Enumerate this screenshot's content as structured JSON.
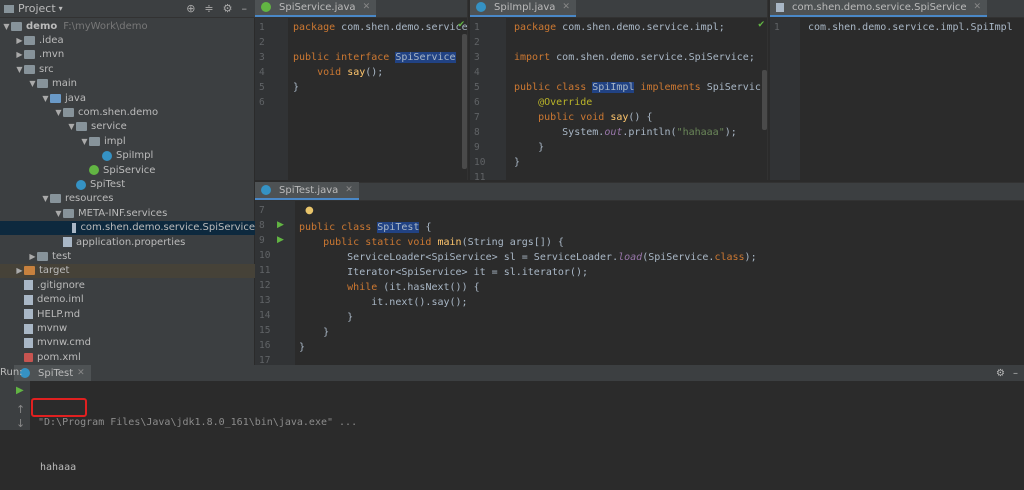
{
  "project": {
    "header_label": "Project",
    "tree": [
      {
        "label": "demo",
        "suffix": "F:\\myWork\\demo",
        "depth": 0,
        "arrow": "▼",
        "icon": "folder",
        "bold": true
      },
      {
        "label": ".idea",
        "depth": 1,
        "arrow": "▶",
        "icon": "folder"
      },
      {
        "label": ".mvn",
        "depth": 1,
        "arrow": "▶",
        "icon": "folder"
      },
      {
        "label": "src",
        "depth": 1,
        "arrow": "▼",
        "icon": "folder"
      },
      {
        "label": "main",
        "depth": 2,
        "arrow": "▼",
        "icon": "folder"
      },
      {
        "label": "java",
        "depth": 3,
        "arrow": "▼",
        "icon": "folder-blue"
      },
      {
        "label": "com.shen.demo",
        "depth": 4,
        "arrow": "▼",
        "icon": "folder"
      },
      {
        "label": "service",
        "depth": 5,
        "arrow": "▼",
        "icon": "folder"
      },
      {
        "label": "impl",
        "depth": 6,
        "arrow": "▼",
        "icon": "folder"
      },
      {
        "label": "SpiImpl",
        "depth": 7,
        "arrow": "",
        "icon": "class"
      },
      {
        "label": "SpiService",
        "depth": 6,
        "arrow": "",
        "icon": "interface"
      },
      {
        "label": "SpiTest",
        "depth": 5,
        "arrow": "",
        "icon": "class"
      },
      {
        "label": "resources",
        "depth": 3,
        "arrow": "▼",
        "icon": "folder"
      },
      {
        "label": "META-INF.services",
        "depth": 4,
        "arrow": "▼",
        "icon": "folder"
      },
      {
        "label": "com.shen.demo.service.SpiService",
        "depth": 5,
        "arrow": "",
        "icon": "file",
        "selected": true
      },
      {
        "label": "application.properties",
        "depth": 4,
        "arrow": "",
        "icon": "file"
      },
      {
        "label": "test",
        "depth": 2,
        "arrow": "▶",
        "icon": "folder"
      },
      {
        "label": "target",
        "depth": 1,
        "arrow": "▶",
        "icon": "folder-orange",
        "highlight": true
      },
      {
        "label": ".gitignore",
        "depth": 1,
        "arrow": "",
        "icon": "file"
      },
      {
        "label": "demo.iml",
        "depth": 1,
        "arrow": "",
        "icon": "file"
      },
      {
        "label": "HELP.md",
        "depth": 1,
        "arrow": "",
        "icon": "file"
      },
      {
        "label": "mvnw",
        "depth": 1,
        "arrow": "",
        "icon": "file"
      },
      {
        "label": "mvnw.cmd",
        "depth": 1,
        "arrow": "",
        "icon": "file"
      },
      {
        "label": "pom.xml",
        "depth": 1,
        "arrow": "",
        "icon": "maven"
      }
    ]
  },
  "editors": {
    "spiservice": {
      "tab": "SpiService.java",
      "lines": [
        "1",
        "2",
        "3",
        "4",
        "5",
        "6"
      ],
      "code": [
        [
          {
            "t": "package ",
            "c": "kw"
          },
          {
            "t": "com.shen.demo.service"
          }
        ],
        [
          {
            "t": ""
          }
        ],
        [
          {
            "t": "public interface ",
            "c": "kw"
          },
          {
            "t": "SpiService",
            "c": "sel-id"
          },
          {
            "t": " {"
          }
        ],
        [
          {
            "t": "    void ",
            "c": "kw"
          },
          {
            "t": "say",
            "c": "fn"
          },
          {
            "t": "();"
          }
        ],
        [
          {
            "t": "}"
          }
        ],
        [
          {
            "t": ""
          }
        ]
      ]
    },
    "spiimpl": {
      "tab": "SpiImpl.java",
      "lines": [
        "1",
        "2",
        "3",
        "4",
        "5",
        "6",
        "7",
        "8",
        "9",
        "10",
        "11"
      ],
      "code": [
        [
          {
            "t": "package ",
            "c": "kw"
          },
          {
            "t": "com.shen.demo.service.impl;"
          }
        ],
        [
          {
            "t": ""
          }
        ],
        [
          {
            "t": "import ",
            "c": "kw"
          },
          {
            "t": "com.shen.demo.service.SpiService;"
          }
        ],
        [
          {
            "t": ""
          }
        ],
        [
          {
            "t": "public class ",
            "c": "kw"
          },
          {
            "t": "SpiImpl",
            "c": "sel-id"
          },
          {
            "t": " implements ",
            "c": "kw"
          },
          {
            "t": "SpiService {"
          }
        ],
        [
          {
            "t": "    @Override",
            "c": "ann"
          }
        ],
        [
          {
            "t": "    public void ",
            "c": "kw"
          },
          {
            "t": "say",
            "c": "fn"
          },
          {
            "t": "() {"
          }
        ],
        [
          {
            "t": "        System."
          },
          {
            "t": "out",
            "c": "it"
          },
          {
            "t": ".println("
          },
          {
            "t": "\"hahaaa\"",
            "c": "str"
          },
          {
            "t": ");"
          }
        ],
        [
          {
            "t": "    }"
          }
        ],
        [
          {
            "t": "}"
          }
        ],
        [
          {
            "t": ""
          }
        ]
      ]
    },
    "spifile": {
      "tab": "com.shen.demo.service.SpiService",
      "lines": [
        "1"
      ],
      "code": [
        [
          {
            "t": "com.shen.demo.service.impl.SpiImpl"
          }
        ]
      ]
    },
    "spitest": {
      "tab": "SpiTest.java",
      "lines": [
        "7",
        "8",
        "9",
        "10",
        "11",
        "12",
        "13",
        "14",
        "15",
        "16",
        "17"
      ],
      "code": [
        [
          {
            "t": ""
          }
        ],
        [
          {
            "t": "public class ",
            "c": "kw"
          },
          {
            "t": "SpiTest",
            "c": "sel-id"
          },
          {
            "t": " {"
          }
        ],
        [
          {
            "t": "    public static void ",
            "c": "kw"
          },
          {
            "t": "main",
            "c": "fn"
          },
          {
            "t": "(String args[]) {"
          }
        ],
        [
          {
            "t": "        ServiceLoader<SpiService> sl = ServiceLoader."
          },
          {
            "t": "load",
            "c": "it"
          },
          {
            "t": "(SpiService."
          },
          {
            "t": "class",
            "c": "kw"
          },
          {
            "t": ");"
          }
        ],
        [
          {
            "t": "        Iterator<SpiService> it = sl.iterator();"
          }
        ],
        [
          {
            "t": "        while ",
            "c": "kw"
          },
          {
            "t": "(it.hasNext()) {"
          }
        ],
        [
          {
            "t": "            it.next().say();"
          }
        ],
        [
          {
            "t": "        }"
          }
        ],
        [
          {
            "t": "    }"
          }
        ],
        [
          {
            "t": "}"
          }
        ],
        [
          {
            "t": ""
          }
        ]
      ]
    }
  },
  "run": {
    "label": "Run:",
    "tab": "SpiTest",
    "command": "\"D:\\Program Files\\Java\\jdk1.8.0_161\\bin\\java.exe\" ...",
    "output": "hahaaa"
  },
  "colors": {
    "accent": "#4a88c7",
    "highlight_box": "#e02020",
    "selection": "#0d293e"
  }
}
